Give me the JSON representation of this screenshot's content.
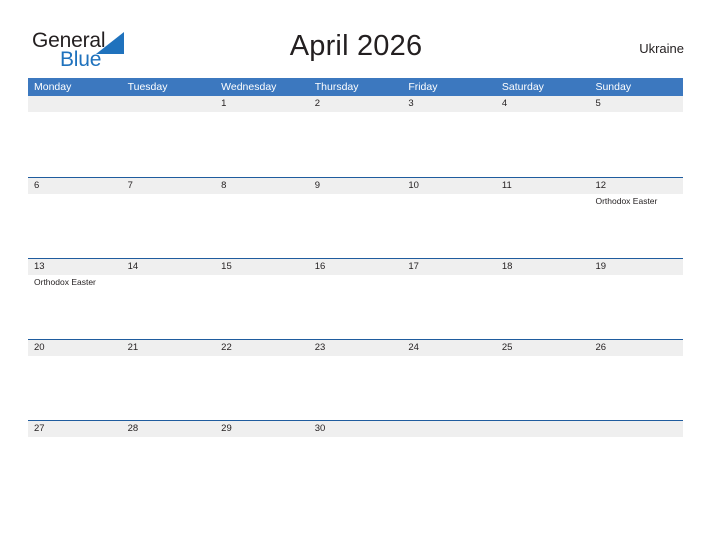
{
  "logo": {
    "word_one": "General",
    "word_two": "Blue",
    "mark": "triangle-icon"
  },
  "header": {
    "title": "April 2026",
    "country": "Ukraine"
  },
  "calendar": {
    "weekdays": [
      "Monday",
      "Tuesday",
      "Wednesday",
      "Thursday",
      "Friday",
      "Saturday",
      "Sunday"
    ],
    "accent_color": "#3c78bf",
    "band_color": "#efefef",
    "border_color": "#1f5c9e",
    "weeks": [
      [
        {
          "day": "",
          "events": []
        },
        {
          "day": "",
          "events": []
        },
        {
          "day": "1",
          "events": []
        },
        {
          "day": "2",
          "events": []
        },
        {
          "day": "3",
          "events": []
        },
        {
          "day": "4",
          "events": []
        },
        {
          "day": "5",
          "events": []
        }
      ],
      [
        {
          "day": "6",
          "events": []
        },
        {
          "day": "7",
          "events": []
        },
        {
          "day": "8",
          "events": []
        },
        {
          "day": "9",
          "events": []
        },
        {
          "day": "10",
          "events": []
        },
        {
          "day": "11",
          "events": []
        },
        {
          "day": "12",
          "events": [
            "Orthodox Easter"
          ]
        }
      ],
      [
        {
          "day": "13",
          "events": [
            "Orthodox Easter"
          ]
        },
        {
          "day": "14",
          "events": []
        },
        {
          "day": "15",
          "events": []
        },
        {
          "day": "16",
          "events": []
        },
        {
          "day": "17",
          "events": []
        },
        {
          "day": "18",
          "events": []
        },
        {
          "day": "19",
          "events": []
        }
      ],
      [
        {
          "day": "20",
          "events": []
        },
        {
          "day": "21",
          "events": []
        },
        {
          "day": "22",
          "events": []
        },
        {
          "day": "23",
          "events": []
        },
        {
          "day": "24",
          "events": []
        },
        {
          "day": "25",
          "events": []
        },
        {
          "day": "26",
          "events": []
        }
      ],
      [
        {
          "day": "27",
          "events": []
        },
        {
          "day": "28",
          "events": []
        },
        {
          "day": "29",
          "events": []
        },
        {
          "day": "30",
          "events": []
        },
        {
          "day": "",
          "events": []
        },
        {
          "day": "",
          "events": []
        },
        {
          "day": "",
          "events": []
        }
      ]
    ]
  }
}
